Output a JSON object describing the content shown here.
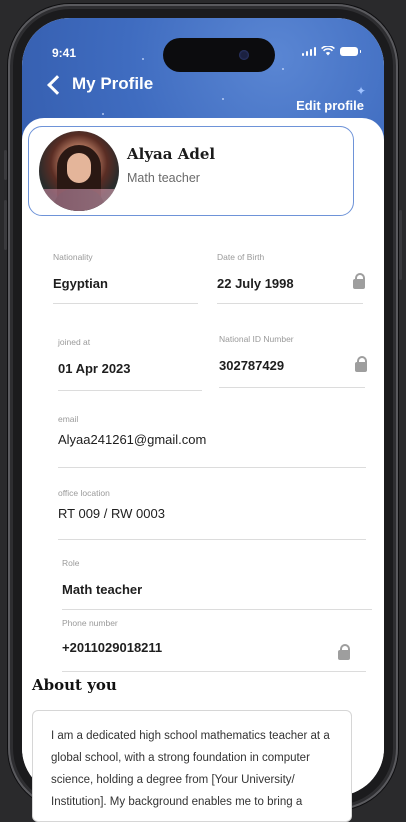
{
  "status_bar": {
    "time": "9:41"
  },
  "header": {
    "title": "My Profile",
    "edit_label": "Edit profile"
  },
  "profile": {
    "name": "Alyaa Adel",
    "role": "Math teacher"
  },
  "fields": {
    "nationality": {
      "label": "Nationality",
      "value": "Egyptian"
    },
    "dob": {
      "label": "Date of Birth",
      "value": "22 July 1998"
    },
    "joined": {
      "label": "joined at",
      "value": "01 Apr 2023"
    },
    "national_id": {
      "label": "National ID Number",
      "value": "302787429"
    },
    "email": {
      "label": "email",
      "value": "Alyaa241261@gmail.com"
    },
    "office": {
      "label": "office location",
      "value": "RT 009 / RW 0003"
    },
    "role": {
      "label": "Role",
      "value": "Math teacher"
    },
    "phone": {
      "label": "Phone number",
      "value": "+2011029018211"
    }
  },
  "about": {
    "title": "About you",
    "text": "I am a dedicated high school mathematics teacher at a global school, with a strong foundation in computer science, holding a degree from [Your University/ Institution]. My background enables me to bring a"
  },
  "colors": {
    "header_blue": "#3f6cc0",
    "card_border": "#6e93d8"
  }
}
